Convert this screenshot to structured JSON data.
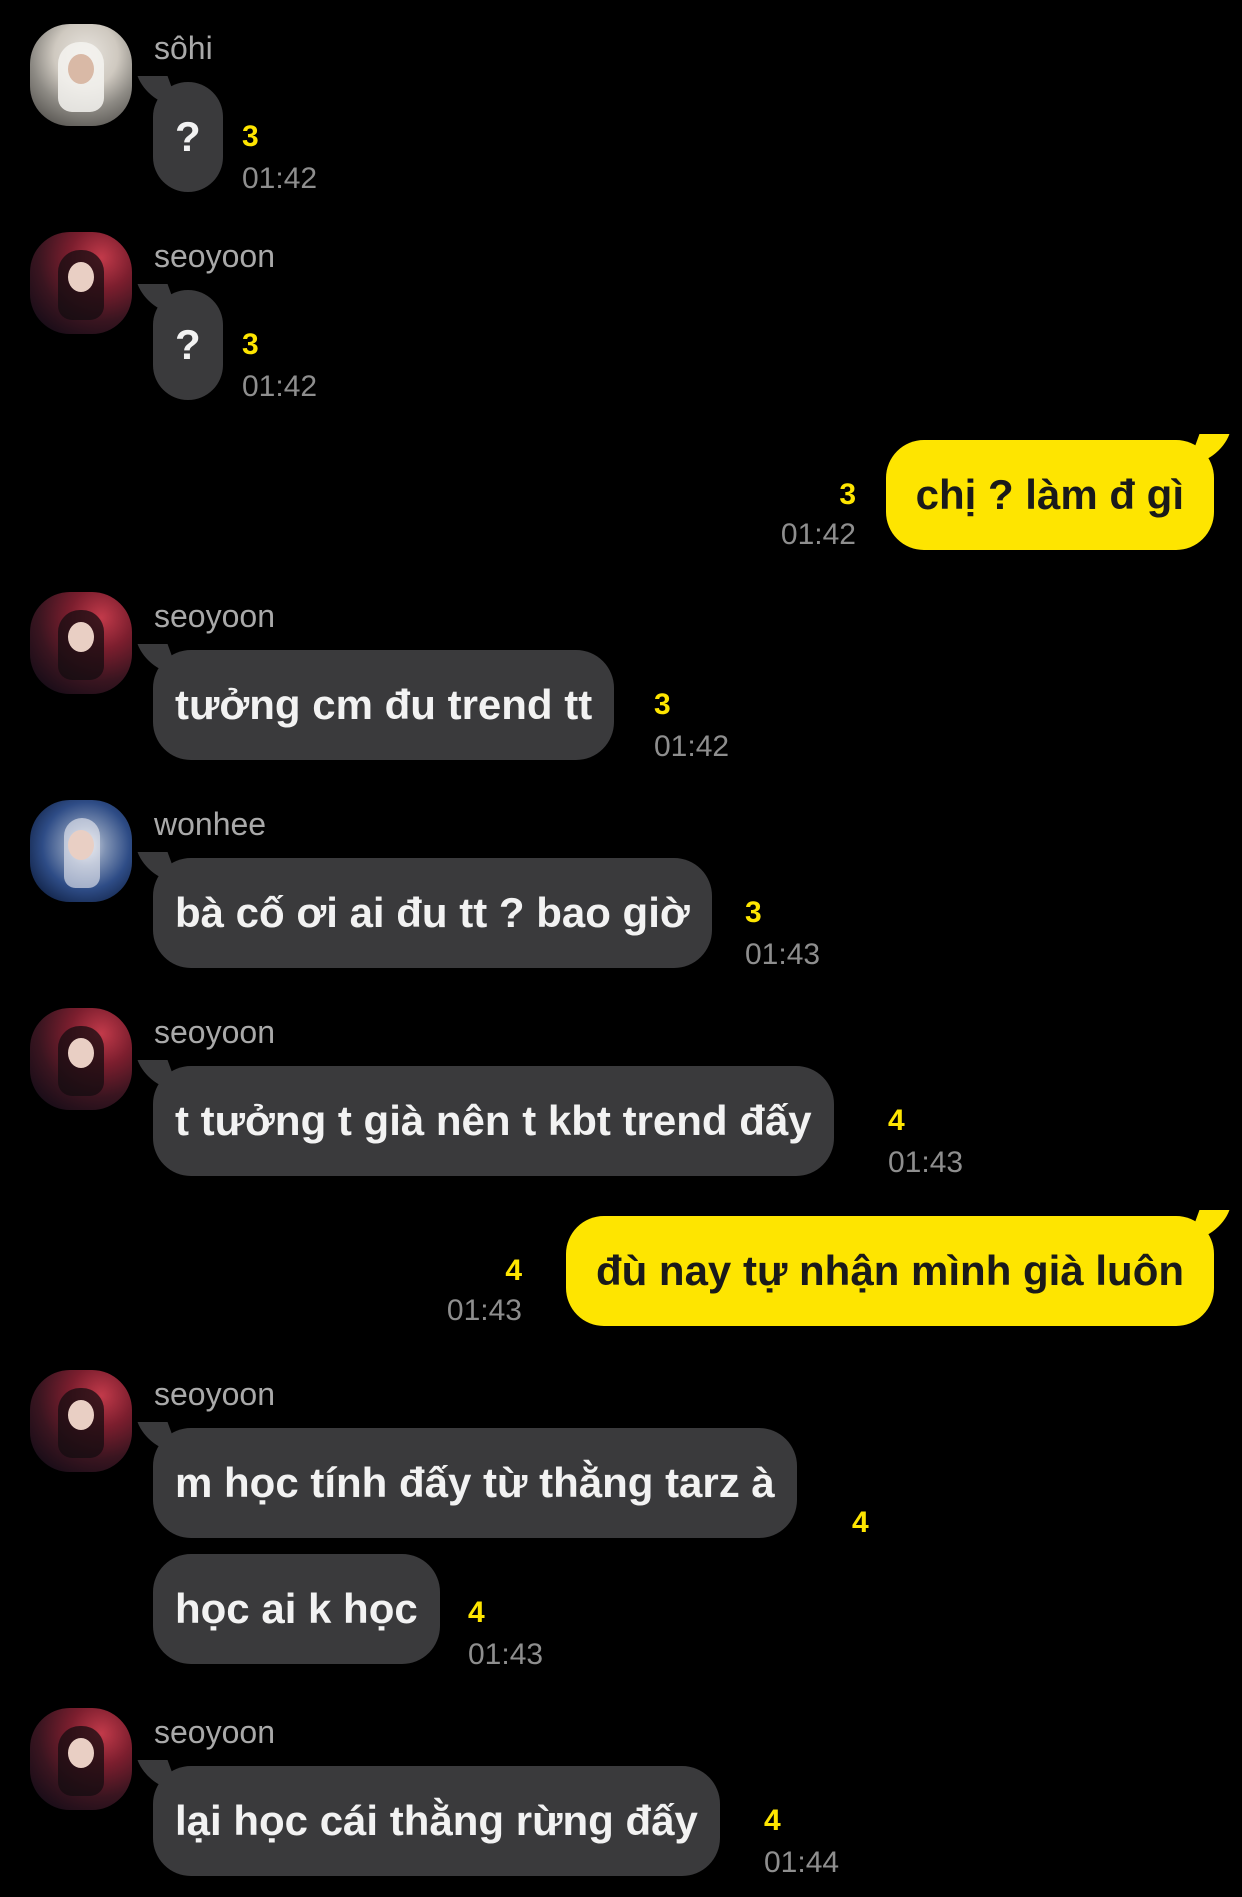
{
  "colors": {
    "background": "#000000",
    "incoming_bubble": "#3a3a3c",
    "outgoing_bubble": "#fee500",
    "unread_count": "#fee500",
    "timestamp": "#8e8e8e",
    "sender_name": "#a9a9a9"
  },
  "messages": [
    {
      "sender": "sôhi",
      "text": "?",
      "unread": "3",
      "time": "01:42"
    },
    {
      "sender": "seoyoon",
      "text": "?",
      "unread": "3",
      "time": "01:42"
    },
    {
      "sender": "me",
      "text": "chị ? làm đ gì",
      "unread": "3",
      "time": "01:42"
    },
    {
      "sender": "seoyoon",
      "text": "tưởng cm đu trend tt",
      "unread": "3",
      "time": "01:42"
    },
    {
      "sender": "wonhee",
      "text": "bà cố ơi ai đu tt ? bao giờ",
      "unread": "3",
      "time": "01:43"
    },
    {
      "sender": "seoyoon",
      "text": "t tưởng t già nên t kbt trend đấy",
      "unread": "4",
      "time": "01:43"
    },
    {
      "sender": "me",
      "text": "đù nay tự nhận mình già luôn",
      "unread": "4",
      "time": "01:43"
    },
    {
      "sender": "seoyoon",
      "text": "m học tính đấy từ thằng tarz à",
      "unread": "4",
      "time": ""
    },
    {
      "sender": "",
      "text": "học ai k học",
      "unread": "4",
      "time": "01:43"
    },
    {
      "sender": "seoyoon",
      "text": "lại học cái thằng rừng đấy",
      "unread": "4",
      "time": "01:44"
    }
  ]
}
